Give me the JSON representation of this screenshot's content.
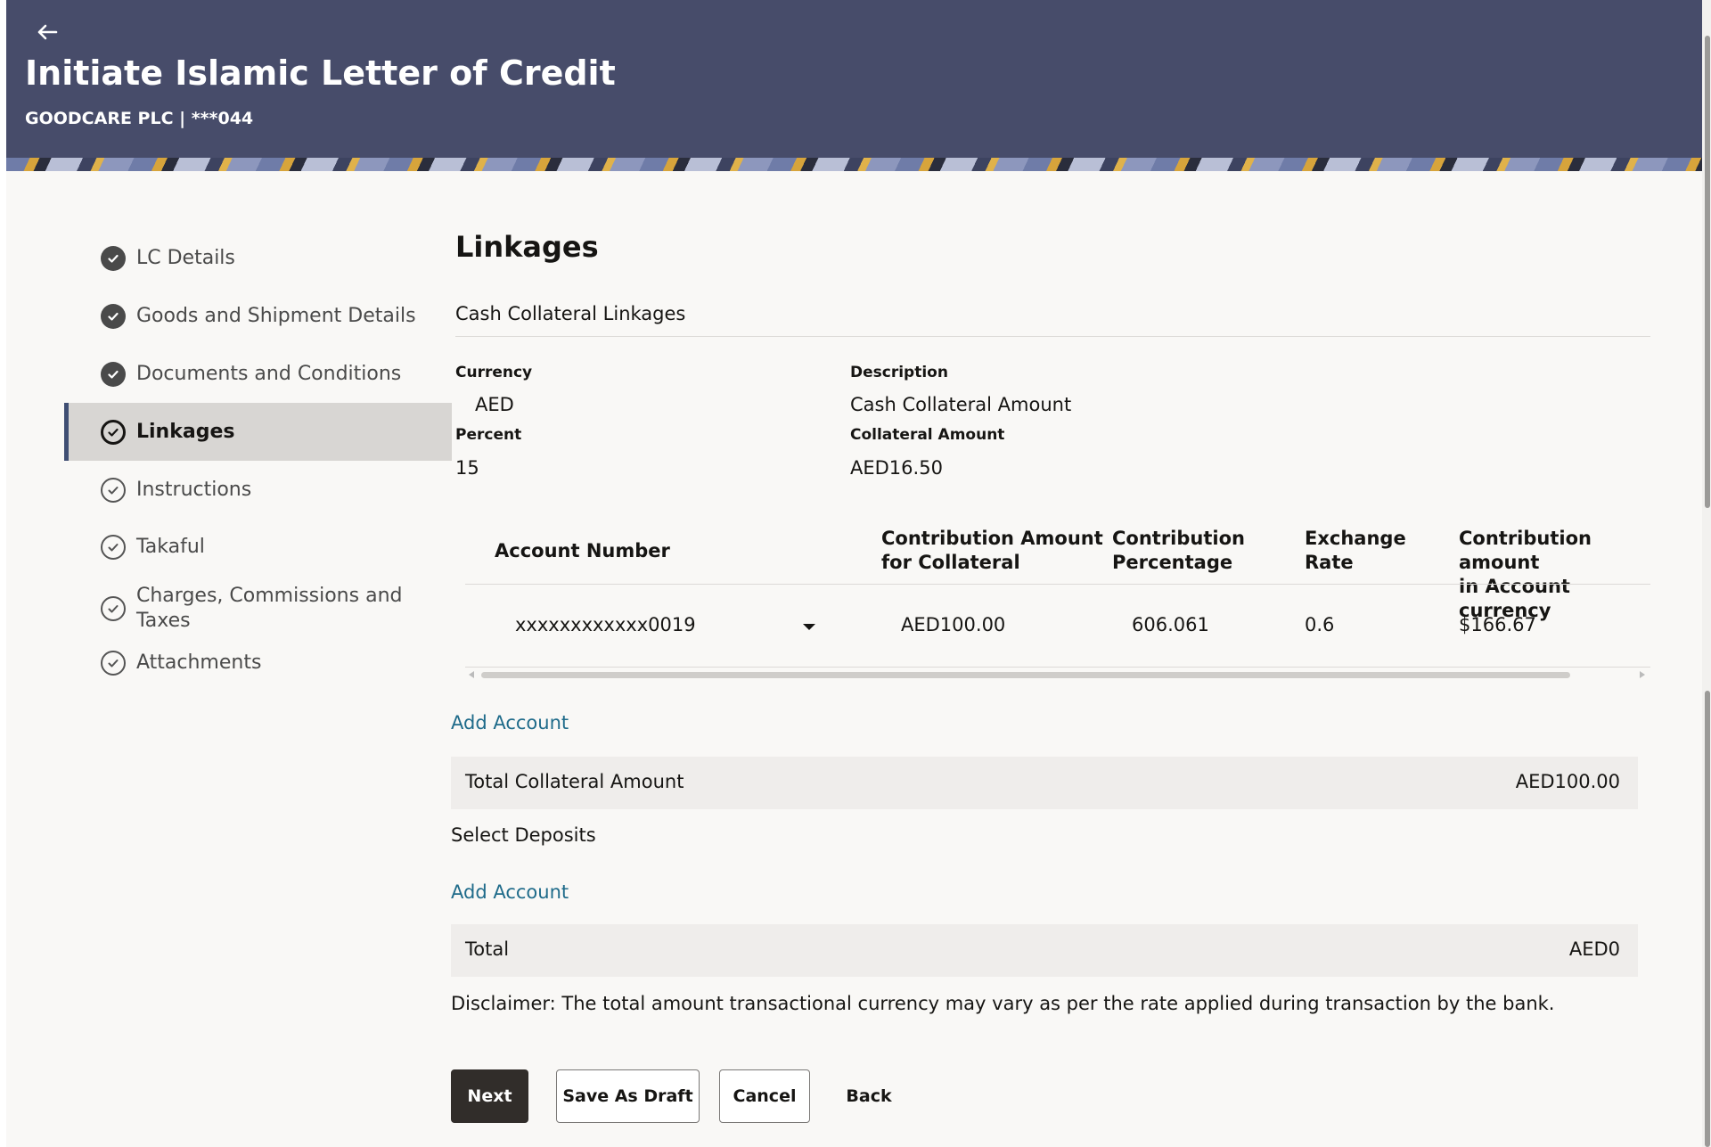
{
  "header": {
    "title": "Initiate Islamic Letter of Credit",
    "subtitle": "GOODCARE PLC | ***044"
  },
  "steps": [
    {
      "label": "LC Details",
      "state": "done"
    },
    {
      "label": "Goods and Shipment Details",
      "state": "done"
    },
    {
      "label": "Documents and Conditions",
      "state": "done"
    },
    {
      "label": "Linkages",
      "state": "active"
    },
    {
      "label": "Instructions",
      "state": "pending"
    },
    {
      "label": "Takaful",
      "state": "pending"
    },
    {
      "label": "Charges, Commissions and Taxes",
      "state": "pending"
    },
    {
      "label": "Attachments",
      "state": "pending"
    }
  ],
  "main": {
    "heading": "Linkages",
    "section_title": "Cash Collateral Linkages",
    "fields": {
      "currency_label": "Currency",
      "currency_value": "AED",
      "description_label": "Description",
      "description_value": "Cash Collateral Amount",
      "percent_label": "Percent",
      "percent_value": "15",
      "collateral_amount_label": "Collateral Amount",
      "collateral_amount_value": "AED16.50"
    },
    "table": {
      "headers": {
        "account_number": "Account Number",
        "contribution_amount_1": "Contribution Amount",
        "contribution_amount_2": "for Collateral",
        "contribution_percentage_1": "Contribution",
        "contribution_percentage_2": "Percentage",
        "exchange_rate_1": "Exchange",
        "exchange_rate_2": "Rate",
        "contribution_account_1": "Contribution amount",
        "contribution_account_2": "in Account currency"
      },
      "rows": [
        {
          "account_number": "xxxxxxxxxxxx0019",
          "contribution_amount": "AED100.00",
          "contribution_percentage": "606.061",
          "exchange_rate": "0.6",
          "contribution_account_currency": "$166.67"
        }
      ]
    },
    "add_account_label": "Add Account",
    "total_collateral_label": "Total Collateral Amount",
    "total_collateral_value": "AED100.00",
    "select_deposits_label": "Select Deposits",
    "add_account_label_2": "Add Account",
    "total_label": "Total",
    "total_value": "AED0",
    "disclaimer": "Disclaimer: The total amount transactional currency may vary as per the rate applied during transaction by the bank."
  },
  "buttons": {
    "next": "Next",
    "save_as_draft": "Save As Draft",
    "cancel": "Cancel",
    "back": "Back"
  },
  "icons": {
    "back": "back-arrow-icon",
    "step_done": "check-circle-filled-icon",
    "step_pending": "check-circle-outline-icon",
    "dropdown": "chevron-down-icon"
  },
  "colors": {
    "header_bg": "#474c6a",
    "link": "#1f6b8a",
    "primary_button": "#312d2a",
    "active_step_bg": "#d8d6d3"
  }
}
